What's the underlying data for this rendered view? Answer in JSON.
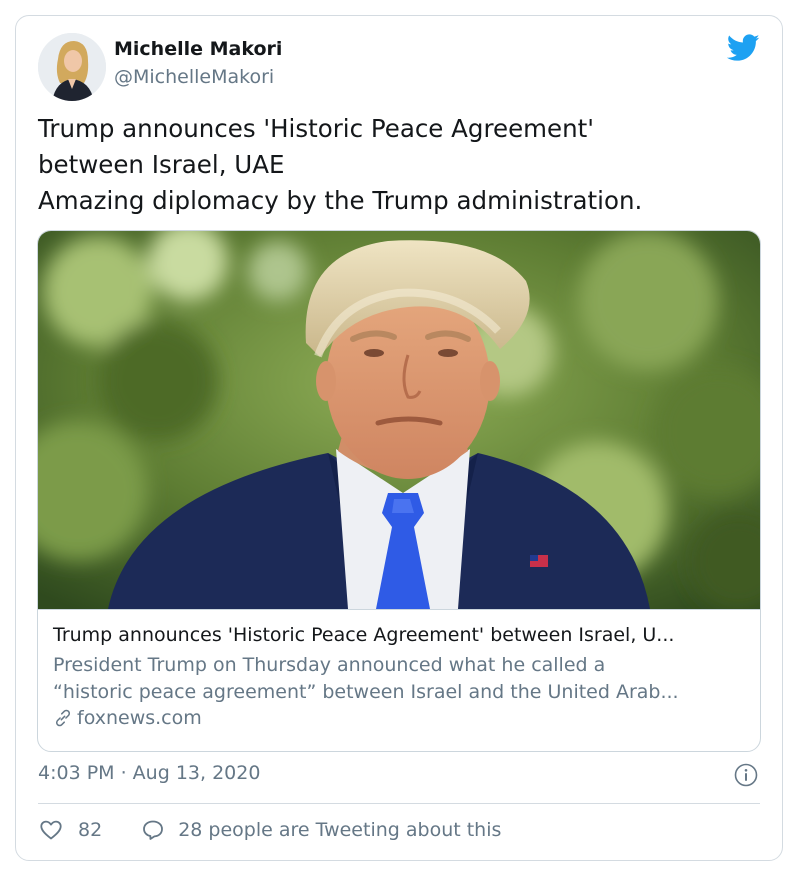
{
  "author": {
    "name": "Michelle Makori",
    "handle": "@MichelleMakori"
  },
  "tweet": {
    "lines": [
      "Trump announces 'Historic Peace Agreement'",
      "between Israel, UAE",
      "Amazing diplomacy by the Trump administration."
    ]
  },
  "link_card": {
    "title": "Trump announces 'Historic Peace Agreement' between Israel, U...",
    "description_lines": [
      "President Trump on Thursday announced what he called a",
      "“historic peace agreement” between Israel and the United Arab..."
    ],
    "domain": "foxnews.com"
  },
  "timestamp": "4:03 PM · Aug 13, 2020",
  "engagement": {
    "likes": "82",
    "tweeting_text": "28 people are Tweeting about this"
  },
  "icons": {
    "brand": "twitter-bird-icon",
    "link": "link-icon",
    "info": "info-icon",
    "like": "heart-icon",
    "reply": "reply-icon"
  },
  "colors": {
    "twitter_blue": "#1da1f2",
    "text_primary": "#14171a",
    "text_secondary": "#657786",
    "border": "#d4dbe1"
  }
}
